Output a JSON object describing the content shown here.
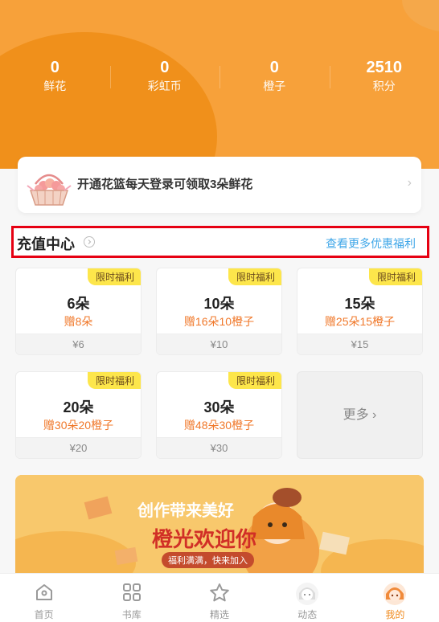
{
  "stats": [
    {
      "value": "0",
      "label": "鲜花"
    },
    {
      "value": "0",
      "label": "彩虹币"
    },
    {
      "value": "0",
      "label": "橙子"
    },
    {
      "value": "2510",
      "label": "积分"
    }
  ],
  "basket": {
    "text": "开通花篮每天登录可领取3朵鲜花"
  },
  "recharge": {
    "title": "充值中心",
    "more_link": "查看更多优惠福利"
  },
  "cards": [
    {
      "tag": "限时福利",
      "amount": "6朵",
      "bonus": "赠8朵",
      "price": "¥6"
    },
    {
      "tag": "限时福利",
      "amount": "10朵",
      "bonus": "赠16朵10橙子",
      "price": "¥10"
    },
    {
      "tag": "限时福利",
      "amount": "15朵",
      "bonus": "赠25朵15橙子",
      "price": "¥15"
    },
    {
      "tag": "限时福利",
      "amount": "20朵",
      "bonus": "赠30朵20橙子",
      "price": "¥20"
    },
    {
      "tag": "限时福利",
      "amount": "30朵",
      "bonus": "赠48朵30橙子",
      "price": "¥30"
    }
  ],
  "more_card": {
    "label": "更多 ›"
  },
  "promo": {
    "line1": "创作带来美好",
    "line2": "橙光欢迎你",
    "line3": "福利满满，快来加入"
  },
  "tabs": [
    {
      "label": "首页",
      "icon": "home-icon"
    },
    {
      "label": "书库",
      "icon": "grid-icon"
    },
    {
      "label": "精选",
      "icon": "star-icon"
    },
    {
      "label": "动态",
      "icon": "avatar-icon"
    },
    {
      "label": "我的",
      "icon": "avatar-icon"
    }
  ],
  "colors": {
    "primary": "#f7a13a",
    "accent": "#f08a1d",
    "link": "#3ea6e8",
    "tag": "#fde64b",
    "highlight_border": "#e60012"
  }
}
